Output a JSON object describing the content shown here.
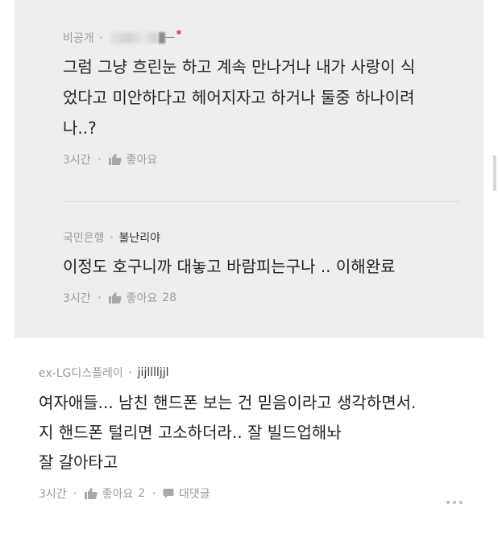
{
  "replies": [
    {
      "author_prefix": "비공개",
      "author_suffix": "ㅡ",
      "op_marker": "*",
      "body": "그럼 그냥 흐린눈 하고 계속 만나거나 내가 사랑이 식\n었다고 미안하다고 헤어지자고 하거나 둘중 하나이려\n나..?",
      "time": "3시간",
      "like_label": "좋아요",
      "like_count": ""
    },
    {
      "affiliation": "국민은행",
      "nickname": "불난리야",
      "body": "이정도 호구니까 대놓고 바람피는구나 .. 이해완료",
      "time": "3시간",
      "like_label": "좋아요",
      "like_count": "28"
    }
  ],
  "comment": {
    "affiliation": "ex-LG디스플레이",
    "nickname": "jijlllljjl",
    "body": "여자애들... 남친 핸드폰 보는 건 믿음이라고 생각하면서.\n지 핸드폰 털리면 고소하더라.. 잘 빌드업해놔\n잘 갈아타고",
    "time": "3시간",
    "like_label": "좋아요",
    "like_count": "2",
    "reply_label": "대댓글"
  },
  "icons": {
    "like": "thumbs-up-icon",
    "reply": "speech-bubble-icon",
    "more": "more-dots-icon"
  },
  "colors": {
    "reply_bg": "#eeeeee",
    "op_marker": "#e0263a",
    "meta_text": "#9a9a9a",
    "body_text": "#222222"
  }
}
